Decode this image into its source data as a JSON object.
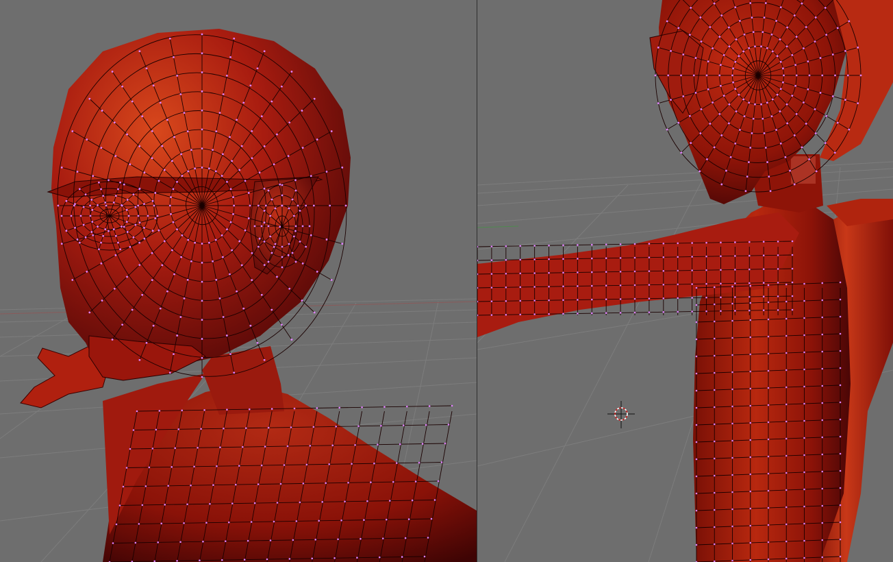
{
  "colors": {
    "viewport_bg": "#6e6e6e",
    "grid_line": "#7b7b7b",
    "axis_x": "#8a5050",
    "axis_y": "#4f8a4f",
    "mesh_fill": "#a81c10",
    "mesh_highlight": "#d6471c",
    "mesh_shadow": "#4a0606",
    "wire": "#1a0000",
    "vertex": "#e080ff",
    "cursor_ring_a": "#ffffff",
    "cursor_ring_b": "#d02020"
  },
  "viewports": {
    "left": {
      "view": "head-closeup",
      "mode": "edit-mesh"
    },
    "right": {
      "view": "torso-arm",
      "mode": "edit-mesh"
    }
  },
  "icons": {
    "cursor": "3d-cursor-icon"
  }
}
